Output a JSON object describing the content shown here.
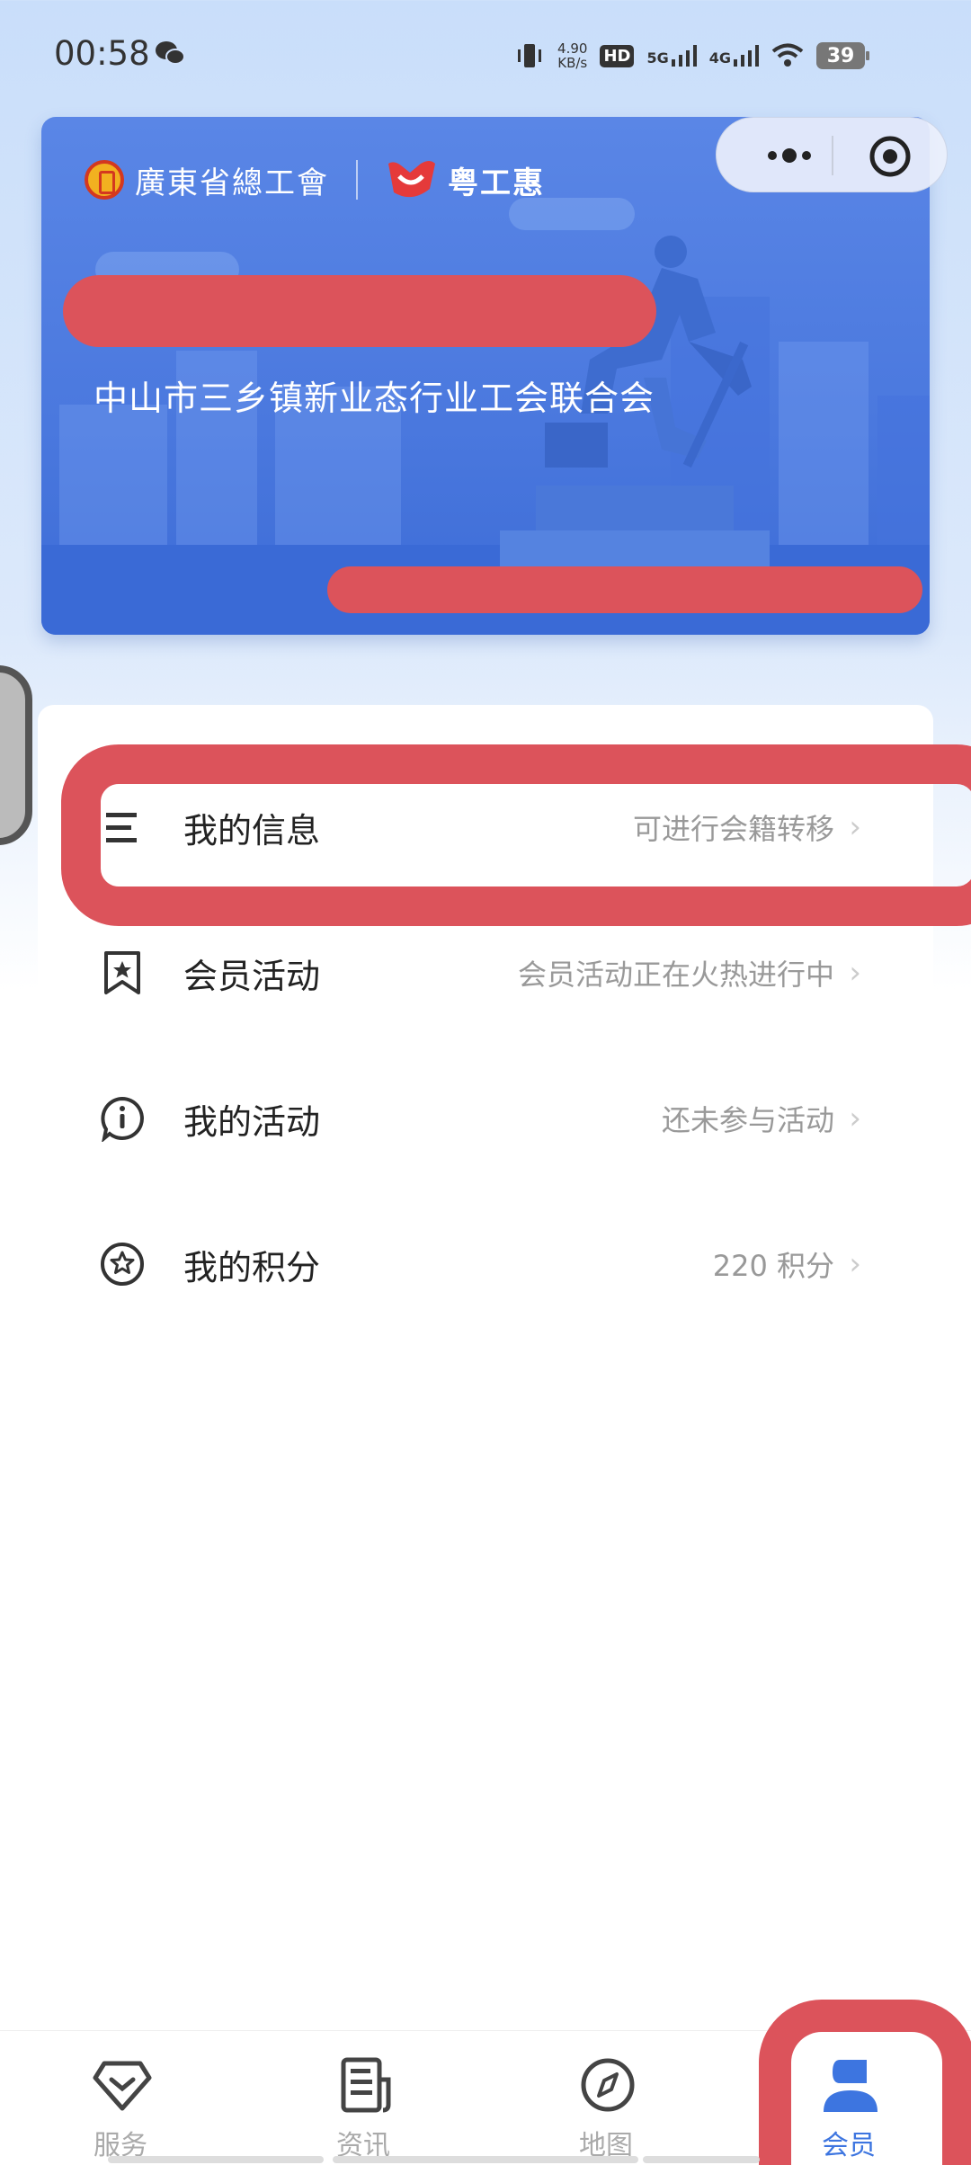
{
  "status_bar": {
    "time": "00:58",
    "speed_value": "4.90",
    "speed_unit": "KB/s",
    "hd_label": "HD",
    "net1": "5G",
    "net2": "4G",
    "battery": "39"
  },
  "banner": {
    "union_name": "廣東省總工會",
    "app_name": "粤工惠",
    "org_name": "中山市三乡镇新业态行业工会联合会"
  },
  "menu": [
    {
      "title": "我的信息",
      "subtitle": "可进行会籍转移",
      "icon": "list-icon"
    },
    {
      "title": "会员活动",
      "subtitle": "会员活动正在火热进行中",
      "icon": "bookmark-star-icon"
    },
    {
      "title": "我的活动",
      "subtitle": "还未参与活动",
      "icon": "info-chat-icon"
    },
    {
      "title": "我的积分",
      "subtitle": "220 积分",
      "icon": "star-circle-icon"
    }
  ],
  "chevron": "›",
  "tabs": [
    {
      "label": "服务",
      "icon": "service-icon",
      "active": false
    },
    {
      "label": "资讯",
      "icon": "news-icon",
      "active": false
    },
    {
      "label": "地图",
      "icon": "compass-icon",
      "active": false
    },
    {
      "label": "会员",
      "icon": "member-icon",
      "active": true
    }
  ],
  "colors": {
    "accent": "#3d75e0",
    "redaction": "#dc535b",
    "banner_blue": "#4a78de"
  }
}
